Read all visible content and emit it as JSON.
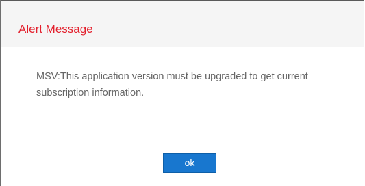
{
  "dialog": {
    "title": "Alert Message",
    "message": "MSV:This application version must be upgraded to get current subscription information.",
    "ok_label": "ok"
  },
  "colors": {
    "title": "#e3202d",
    "button": "#1877cf",
    "header_bg": "#f5f5f5",
    "message_text": "#666666"
  }
}
